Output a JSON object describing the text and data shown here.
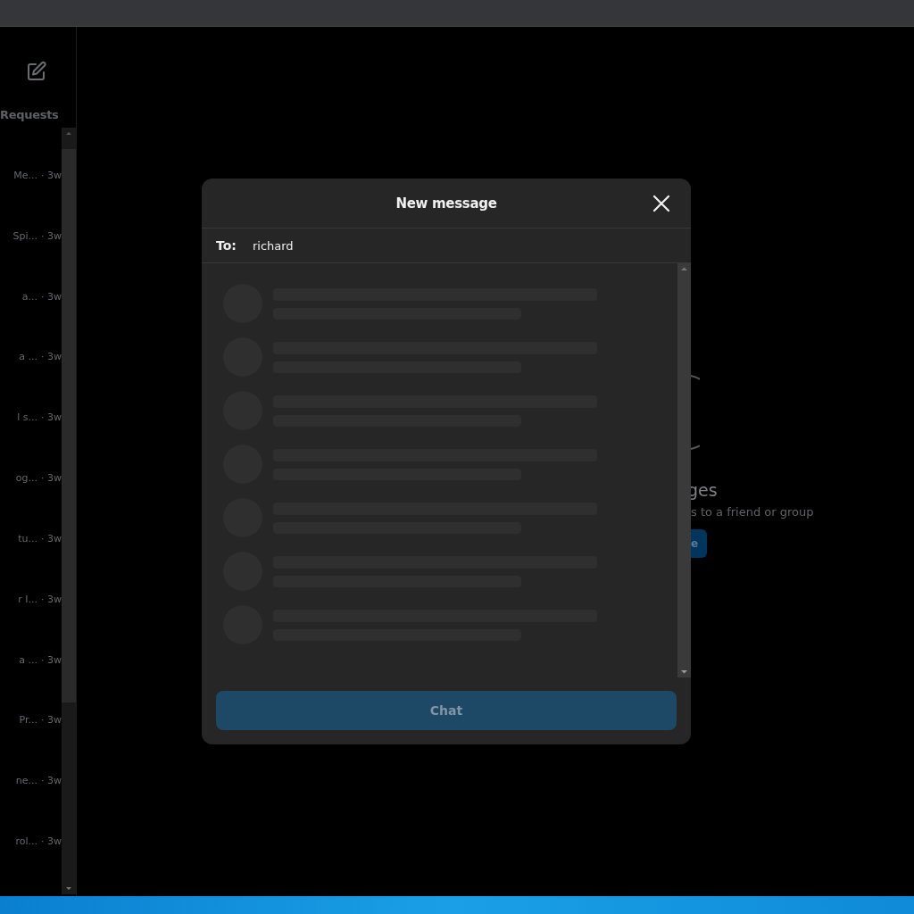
{
  "sidebar": {
    "tab": "Requests",
    "conversations": [
      {
        "preview": "Me...",
        "time": "· 3w"
      },
      {
        "preview": "Spi...",
        "time": "· 3w"
      },
      {
        "preview": "a...",
        "time": "· 3w"
      },
      {
        "preview": "a ...",
        "time": "· 3w"
      },
      {
        "preview": "l s...",
        "time": "· 3w"
      },
      {
        "preview": "og...",
        "time": "· 3w"
      },
      {
        "preview": "tu...",
        "time": "· 3w"
      },
      {
        "preview": "r I...",
        "time": "· 3w"
      },
      {
        "preview": "a ...",
        "time": "· 3w"
      },
      {
        "preview": "Pr...",
        "time": "· 3w"
      },
      {
        "preview": "ne...",
        "time": "· 3w"
      },
      {
        "preview": "rol...",
        "time": "· 3w"
      }
    ]
  },
  "empty_state": {
    "heading": "ges",
    "text": "s to a friend or group",
    "button": "e"
  },
  "dialog": {
    "title": "New message",
    "to_label": "To:",
    "to_value": "richard",
    "results": [
      {
        "kind": "placeholder"
      },
      {
        "kind": "placeholder"
      },
      {
        "kind": "placeholder"
      },
      {
        "kind": "placeholder"
      },
      {
        "kind": "placeholder"
      },
      {
        "kind": "placeholder"
      },
      {
        "kind": "placeholder"
      }
    ],
    "chat_button": {
      "label": "Chat",
      "disabled": true
    }
  }
}
